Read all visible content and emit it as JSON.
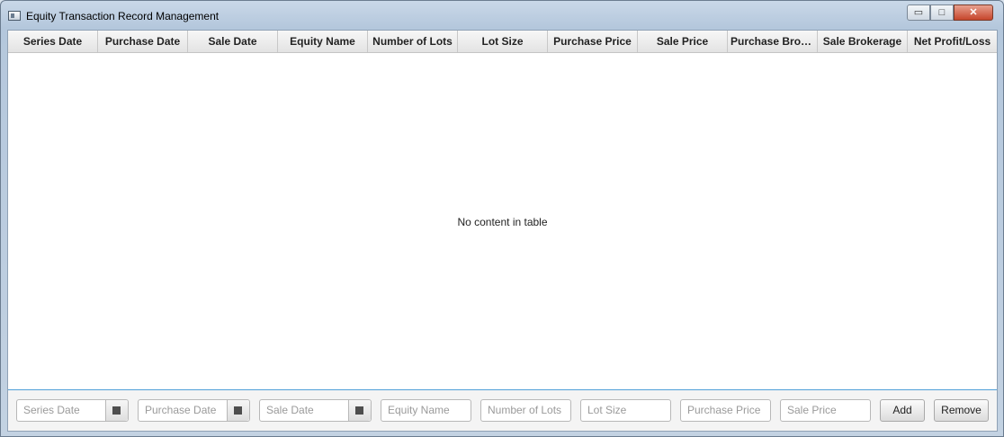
{
  "window": {
    "title": "Equity Transaction Record Management",
    "controls": {
      "minimize": "▭",
      "maximize": "□",
      "close": "✕"
    }
  },
  "table": {
    "columns": [
      "Series Date",
      "Purchase Date",
      "Sale Date",
      "Equity Name",
      "Number of Lots",
      "Lot Size",
      "Purchase Price",
      "Sale Price",
      "Purchase Brok...",
      "Sale Brokerage",
      "Net Profit/Loss"
    ],
    "rows": [],
    "empty_message": "No content in table"
  },
  "form": {
    "series_date_placeholder": "Series Date",
    "purchase_date_placeholder": "Purchase Date",
    "sale_date_placeholder": "Sale Date",
    "equity_name_placeholder": "Equity Name",
    "number_of_lots_placeholder": "Number of Lots",
    "lot_size_placeholder": "Lot Size",
    "purchase_price_placeholder": "Purchase Price",
    "sale_price_placeholder": "Sale Price",
    "add_label": "Add",
    "remove_label": "Remove"
  },
  "colors": {
    "accent": "#4f9fd8",
    "close_button": "#c6452b"
  }
}
